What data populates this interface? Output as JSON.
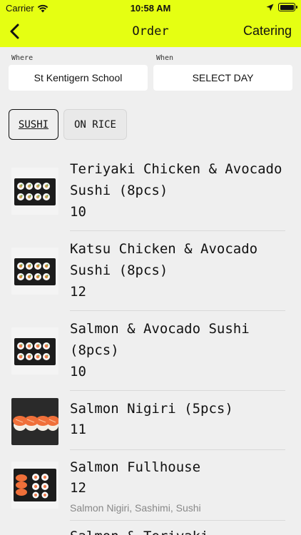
{
  "status": {
    "carrier": "Carrier",
    "time": "10:58 AM"
  },
  "header": {
    "title": "Order",
    "right_link": "Catering"
  },
  "filters": {
    "where_label": "Where",
    "where_value": "St Kentigern School",
    "when_label": "When",
    "when_value": "SELECT DAY"
  },
  "categories": [
    {
      "label": "SUSHI",
      "selected": true
    },
    {
      "label": "ON RICE",
      "selected": false
    }
  ],
  "items": [
    {
      "name": "Teriyaki Chicken & Avocado Sushi (8pcs)",
      "price": "10",
      "description": ""
    },
    {
      "name": "Katsu Chicken & Avocado Sushi (8pcs)",
      "price": "12",
      "description": ""
    },
    {
      "name": "Salmon & Avocado Sushi (8pcs)",
      "price": "10",
      "description": ""
    },
    {
      "name": "Salmon Nigiri (5pcs)",
      "price": "11",
      "description": ""
    },
    {
      "name": "Salmon Fullhouse",
      "price": "12",
      "description": "Salmon Nigiri, Sashimi, Sushi"
    },
    {
      "name": "Salmon & Teriyaki",
      "price": "",
      "description": ""
    }
  ],
  "colors": {
    "accent": "#e5ff12",
    "background": "#efefef"
  }
}
